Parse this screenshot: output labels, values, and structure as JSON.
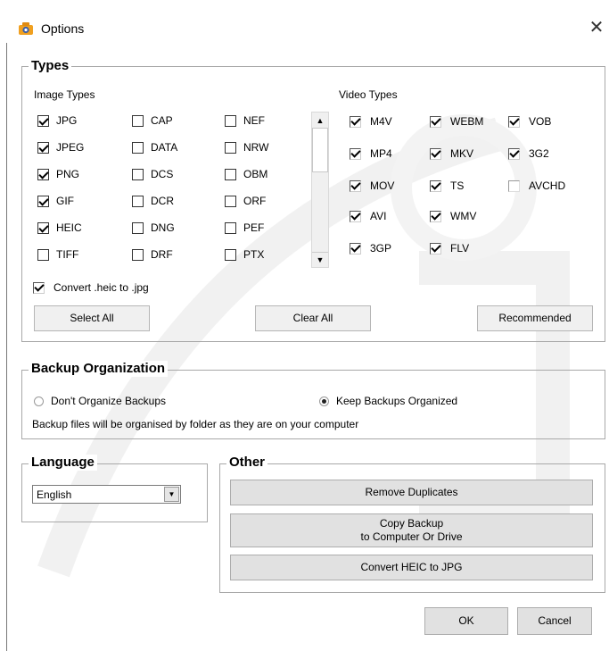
{
  "window": {
    "title": "Options",
    "close_glyph": "✕"
  },
  "types": {
    "legend": "Types",
    "image_label": "Image Types",
    "video_label": "Video Types",
    "image_items": [
      {
        "label": "JPG",
        "checked": true
      },
      {
        "label": "JPEG",
        "checked": true
      },
      {
        "label": "PNG",
        "checked": true
      },
      {
        "label": "GIF",
        "checked": true
      },
      {
        "label": "HEIC",
        "checked": true
      },
      {
        "label": "TIFF",
        "checked": false
      },
      {
        "label": "CAP",
        "checked": false
      },
      {
        "label": "DATA",
        "checked": false
      },
      {
        "label": "DCS",
        "checked": false
      },
      {
        "label": "DCR",
        "checked": false
      },
      {
        "label": "DNG",
        "checked": false
      },
      {
        "label": "DRF",
        "checked": false
      },
      {
        "label": "NEF",
        "checked": false
      },
      {
        "label": "NRW",
        "checked": false
      },
      {
        "label": "OBM",
        "checked": false
      },
      {
        "label": "ORF",
        "checked": false
      },
      {
        "label": "PEF",
        "checked": false
      },
      {
        "label": "PTX",
        "checked": false
      }
    ],
    "video_items": [
      {
        "label": "M4V",
        "checked": true
      },
      {
        "label": "MP4",
        "checked": true
      },
      {
        "label": "MOV",
        "checked": true
      },
      {
        "label": "AVI",
        "checked": true
      },
      {
        "label": "3GP",
        "checked": true
      },
      {
        "label": "WEBM",
        "checked": true
      },
      {
        "label": "MKV",
        "checked": true
      },
      {
        "label": "TS",
        "checked": true
      },
      {
        "label": "WMV",
        "checked": true
      },
      {
        "label": "FLV",
        "checked": true
      },
      {
        "label": "VOB",
        "checked": true
      },
      {
        "label": "3G2",
        "checked": true
      },
      {
        "label": "AVCHD",
        "checked": false
      }
    ],
    "convert_heic": {
      "label": "Convert .heic to .jpg",
      "checked": true
    },
    "select_all": "Select All",
    "clear_all": "Clear All",
    "recommended": "Recommended"
  },
  "backup": {
    "legend": "Backup Organization",
    "option_dont": "Don't Organize Backups",
    "option_keep": "Keep Backups Organized",
    "selected": "keep",
    "note": "Backup files will be organised by folder as they are on your computer"
  },
  "language": {
    "legend": "Language",
    "selected": "English"
  },
  "other": {
    "legend": "Other",
    "remove_duplicates": "Remove Duplicates",
    "copy_backup_line1": "Copy Backup",
    "copy_backup_line2": "to Computer Or Drive",
    "convert_heic": "Convert HEIC to JPG"
  },
  "footer": {
    "ok": "OK",
    "cancel": "Cancel"
  },
  "icons": {
    "app": "camera-app-icon",
    "close": "close-icon",
    "scroll_up": "scroll-up-arrow-icon",
    "scroll_down": "scroll-down-arrow-icon",
    "dropdown": "chevron-down-icon"
  },
  "colors": {
    "accent_icon": "#f0a020",
    "border": "#a8a8a8",
    "button_bg": "#e1e1e1"
  }
}
